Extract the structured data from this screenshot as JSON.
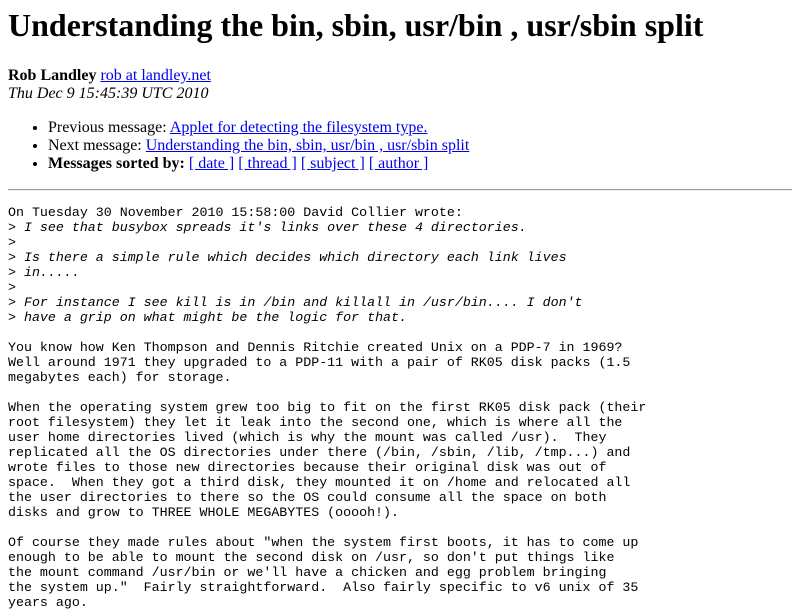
{
  "title": "Understanding the bin, sbin, usr/bin , usr/sbin split",
  "author": {
    "name": "Rob Landley",
    "email": "rob at landley.net "
  },
  "date": "Thu Dec 9 15:45:39 UTC 2010",
  "nav": {
    "previous_label": "Previous message: ",
    "previous_link": "Applet for detecting the filesystem type.",
    "next_label": "Next message: ",
    "next_link": "Understanding the bin, sbin, usr/bin , usr/sbin split",
    "sorted_label": "Messages sorted by:",
    "sort_links": [
      "[ date ]",
      "[ thread ]",
      "[ subject ]",
      "[ author ]"
    ]
  },
  "body": {
    "attribution": "On Tuesday 30 November 2010 15:58:00 David Collier wrote:",
    "quoted": [
      "I see that busybox spreads it's links over these 4 directories.",
      "",
      "Is there a simple rule which decides which directory each link lives",
      "in.....",
      "",
      "For instance I see kill is in /bin and killall in /usr/bin.... I don't",
      "have a grip on what might be the logic for that."
    ],
    "paragraphs": [
      "You know how Ken Thompson and Dennis Ritchie created Unix on a PDP-7 in 1969?\nWell around 1971 they upgraded to a PDP-11 with a pair of RK05 disk packs (1.5\nmegabytes each) for storage.",
      "When the operating system grew too big to fit on the first RK05 disk pack (their\nroot filesystem) they let it leak into the second one, which is where all the\nuser home directories lived (which is why the mount was called /usr).  They\nreplicated all the OS directories under there (/bin, /sbin, /lib, /tmp...) and\nwrote files to those new directories because their original disk was out of\nspace.  When they got a third disk, they mounted it on /home and relocated all\nthe user directories to there so the OS could consume all the space on both\ndisks and grow to THREE WHOLE MEGABYTES (ooooh!).",
      "Of course they made rules about \"when the system first boots, it has to come up\nenough to be able to mount the second disk on /usr, so don't put things like\nthe mount command /usr/bin or we'll have a chicken and egg problem bringing\nthe system up.\"  Fairly straightforward.  Also fairly specific to v6 unix of 35\nyears ago."
    ]
  }
}
